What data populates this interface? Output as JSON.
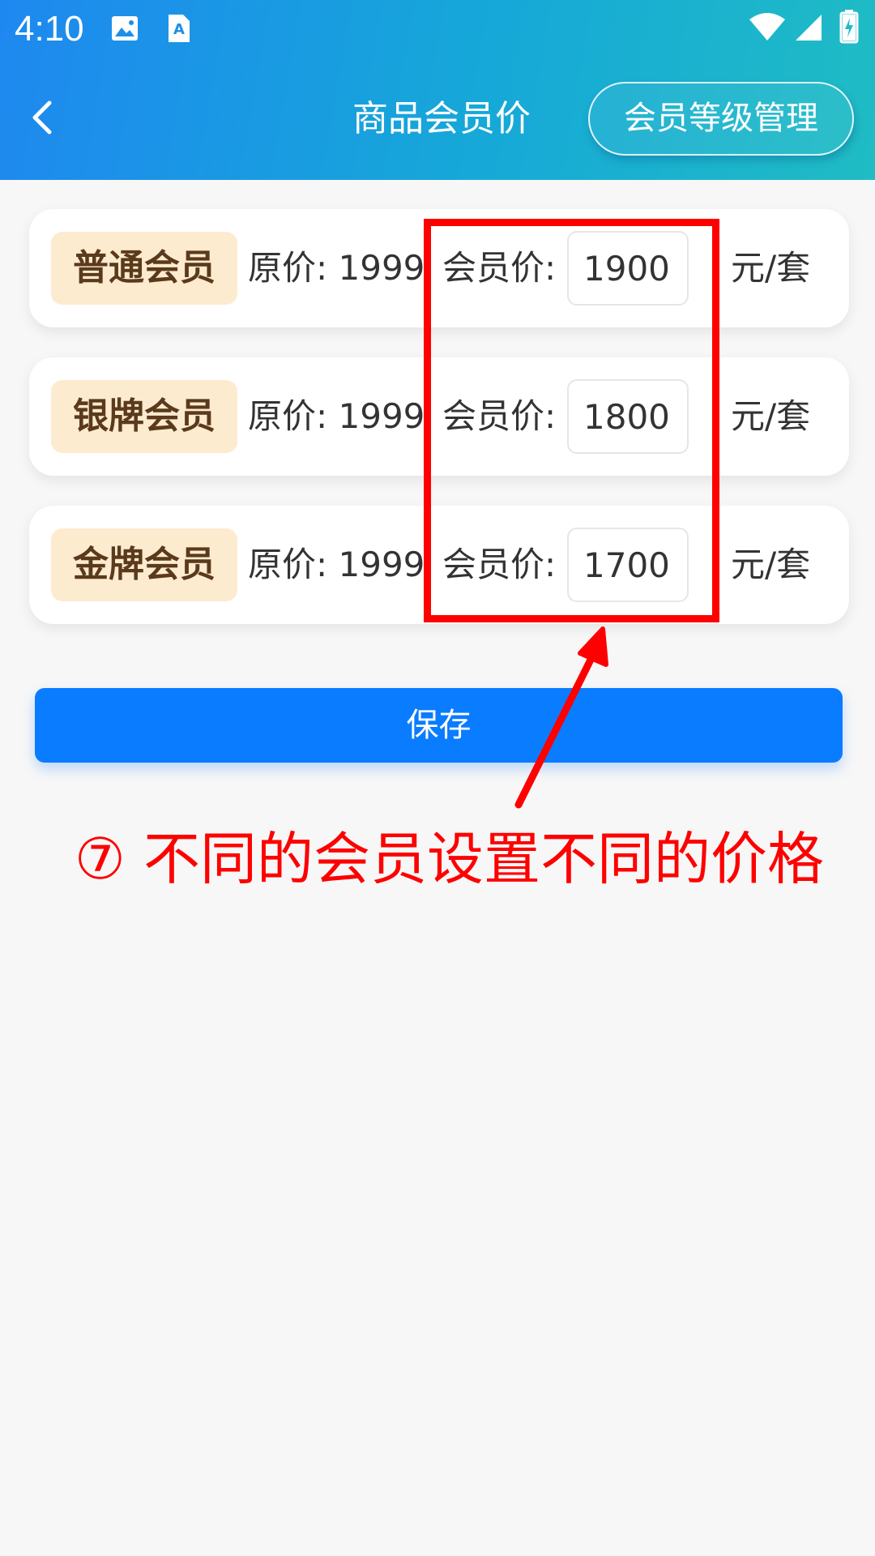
{
  "status_bar": {
    "time": "4:10",
    "icons": [
      "image-icon",
      "text-a-icon",
      "wifi-icon",
      "signal-icon",
      "battery-charging-icon"
    ]
  },
  "header": {
    "title": "商品会员价",
    "back_icon": "chevron-left-icon",
    "member_level_button": "会员等级管理"
  },
  "member_prices": [
    {
      "level": "普通会员",
      "original_price": "原价: 1999",
      "member_price_label": "会员价:",
      "member_price_value": "1900",
      "unit": "元/套"
    },
    {
      "level": "银牌会员",
      "original_price": "原价: 1999",
      "member_price_label": "会员价:",
      "member_price_value": "1800",
      "unit": "元/套"
    },
    {
      "level": "金牌会员",
      "original_price": "原价: 1999",
      "member_price_label": "会员价:",
      "member_price_value": "1700",
      "unit": "元/套"
    }
  ],
  "save_button": "保存",
  "annotation": {
    "text": "⑦ 不同的会员设置不同的价格",
    "color": "#ff0000"
  },
  "colors": {
    "header_gradient": [
      "#1e88f0",
      "#1fbcc4"
    ],
    "save_button": "#0a7cff",
    "level_tag_bg": "#fdebd0",
    "level_tag_text": "#5b3a1c"
  }
}
